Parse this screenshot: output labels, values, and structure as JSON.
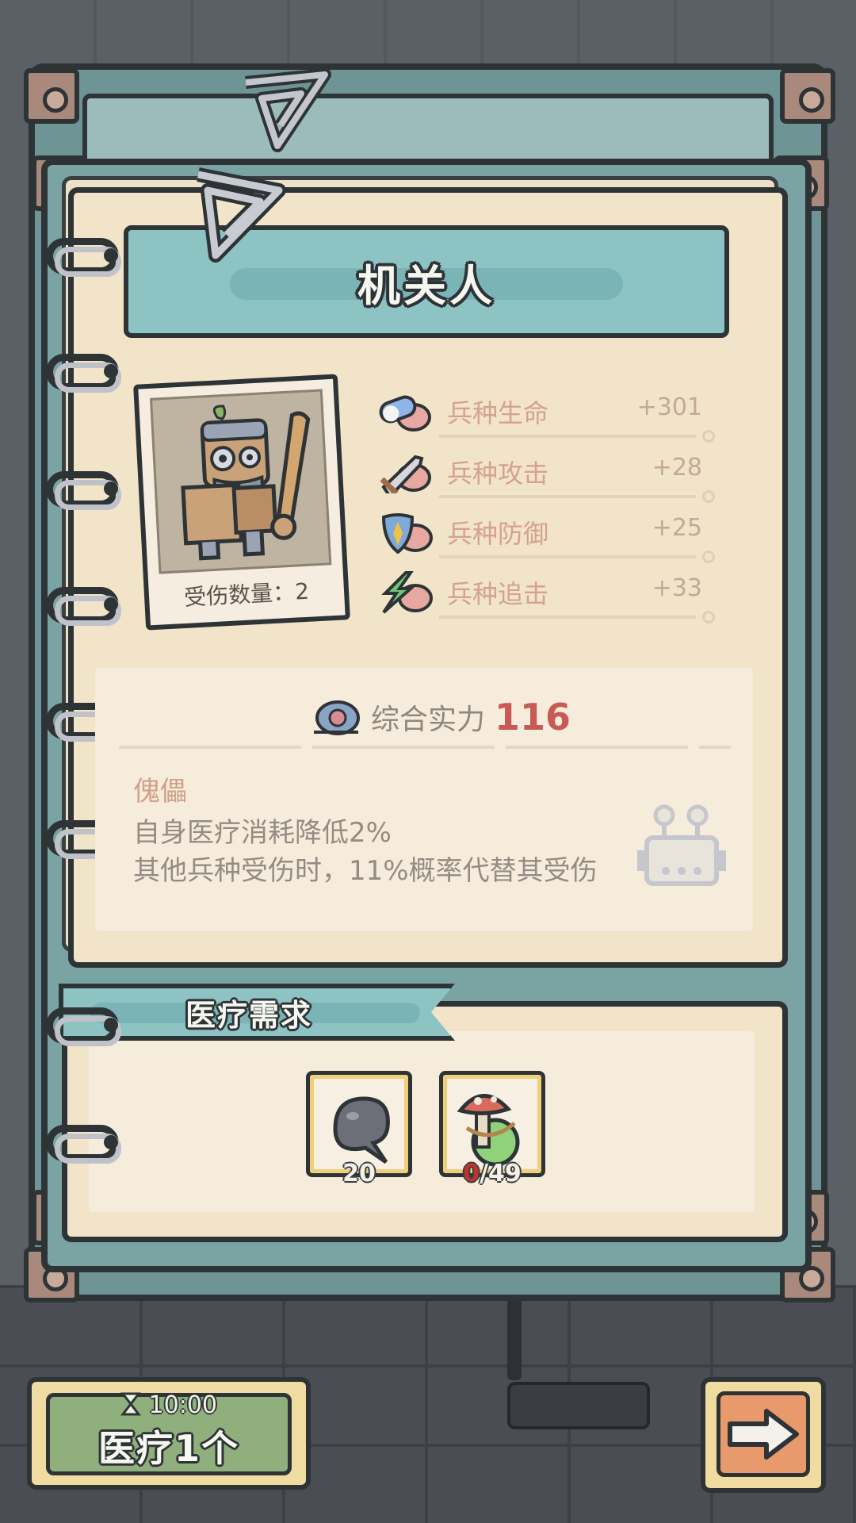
{
  "unit": {
    "name": "机关人",
    "injured_label": "受伤数量",
    "injured_count": "2",
    "injured_text": "受伤数量：2",
    "portrait_icon": "robot-warrior-icon"
  },
  "stats": [
    {
      "label": "兵种生命",
      "value": "+301",
      "icon": "pill-snail-icon"
    },
    {
      "label": "兵种攻击",
      "value": "+28",
      "icon": "sword-snail-icon"
    },
    {
      "label": "兵种防御",
      "value": "+25",
      "icon": "shield-snail-icon"
    },
    {
      "label": "兵种追击",
      "value": "+33",
      "icon": "lightning-snail-icon"
    }
  ],
  "power": {
    "label": "综合实力",
    "value": "116",
    "icon": "snail-power-icon"
  },
  "trait": {
    "name": "傀儡",
    "lines": [
      "自身医疗消耗降低2%",
      "其他兵种受伤时，11%概率代替其受伤"
    ],
    "icon": "robot-head-icon"
  },
  "medical": {
    "title": "医疗需求",
    "items": [
      {
        "icon": "black-slime-icon",
        "count": "20"
      },
      {
        "icon": "mushroom-potion-icon",
        "have": "0",
        "need": "/49"
      }
    ]
  },
  "buttons": {
    "heal_timer": "10:00",
    "heal_label": "医疗1个",
    "heal_icon": "hourglass-icon",
    "next_icon": "arrow-right-icon"
  },
  "colors": {
    "banner": "#8ec3c4",
    "paper": "#f1e4c9",
    "power_value": "#c85a55",
    "heal_button": "#8fb07d",
    "next_button": "#e89a6d"
  }
}
